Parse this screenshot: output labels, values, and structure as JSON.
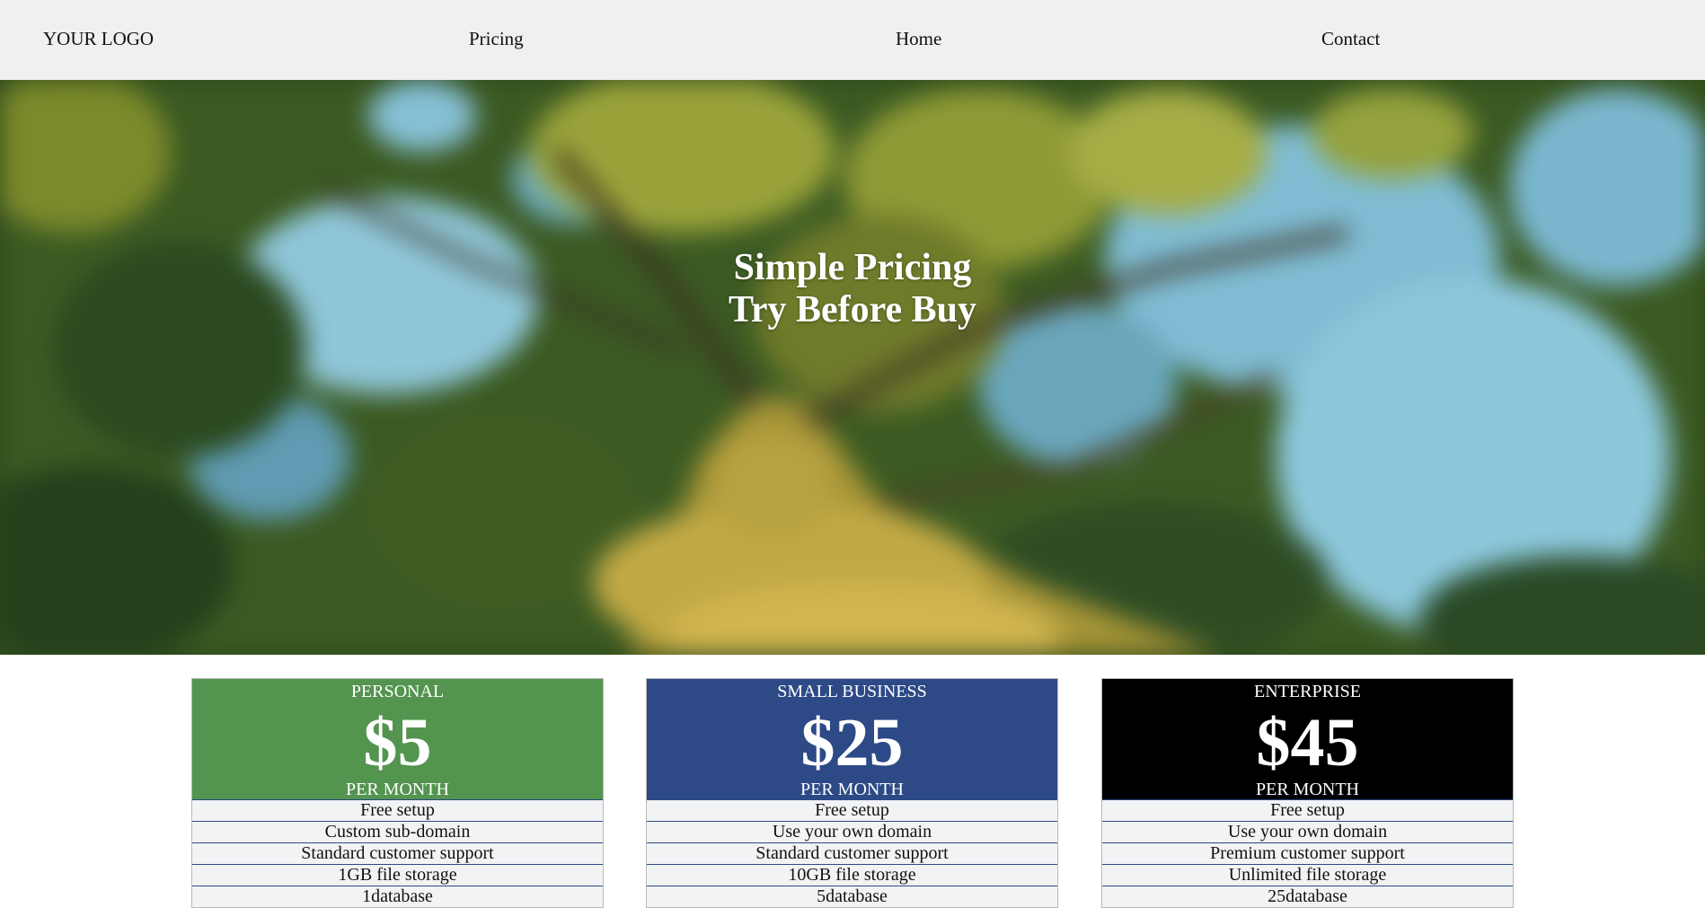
{
  "nav": {
    "logo": "YOUR LOGO",
    "links": [
      "Pricing",
      "Home",
      "Contact"
    ]
  },
  "hero": {
    "line1": "Simple Pricing",
    "line2": "Try Before Buy"
  },
  "colors": {
    "personal": "#53944f",
    "small_business": "#2d4a87",
    "enterprise": "#000000",
    "nav_bg": "#f0f0f0"
  },
  "plans": [
    {
      "name": "PERSONAL",
      "price": "$5",
      "period": "PER MONTH",
      "features": [
        "Free setup",
        "Custom sub-domain",
        "Standard customer support",
        "1GB file storage",
        "1database"
      ]
    },
    {
      "name": "SMALL BUSINESS",
      "price": "$25",
      "period": "PER MONTH",
      "features": [
        "Free setup",
        "Use your own domain",
        "Standard customer support",
        "10GB file storage",
        "5database"
      ]
    },
    {
      "name": "ENTERPRISE",
      "price": "$45",
      "period": "PER MONTH",
      "features": [
        "Free setup",
        "Use your own domain",
        "Premium customer support",
        "Unlimited file storage",
        "25database"
      ]
    }
  ]
}
